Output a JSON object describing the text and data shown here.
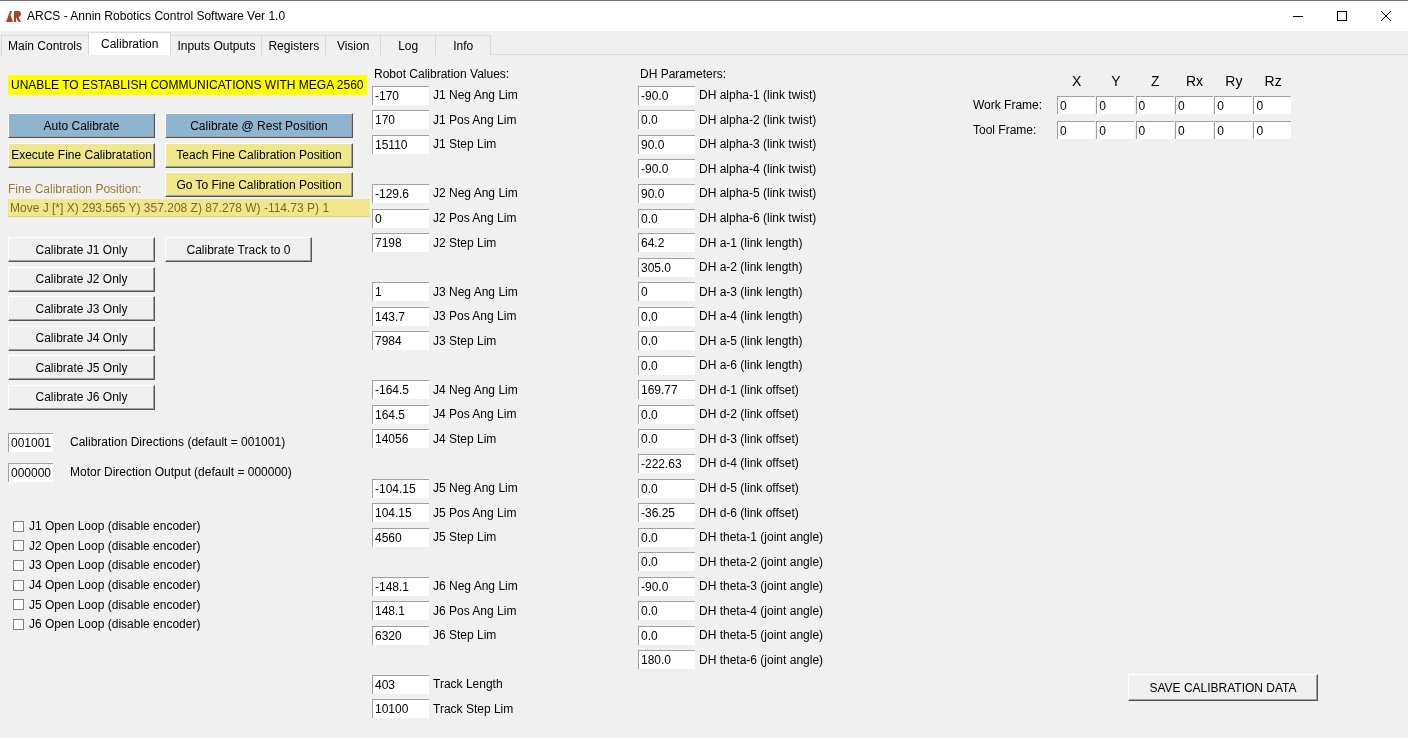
{
  "window": {
    "title": "ARCS - Annin Robotics Control Software Ver 1.0"
  },
  "tabs": [
    {
      "label": "Main Controls",
      "selected": false
    },
    {
      "label": "Calibration",
      "selected": true
    },
    {
      "label": "Inputs Outputs",
      "selected": false
    },
    {
      "label": "Registers",
      "selected": false
    },
    {
      "label": "Vision",
      "selected": false
    },
    {
      "label": "Log",
      "selected": false
    },
    {
      "label": "Info",
      "selected": false
    }
  ],
  "status_message": "UNABLE TO ESTABLISH COMMUNICATIONS WITH MEGA 2560",
  "calibration_buttons": {
    "left": [
      {
        "label": "Auto Calibrate",
        "kind": "auto"
      },
      {
        "label": "Execute Fine Calibratation",
        "kind": "fine"
      }
    ],
    "right": [
      {
        "label": "Calibrate @ Rest Position",
        "kind": "auto"
      },
      {
        "label": "Teach Fine Calibration Position",
        "kind": "fine"
      },
      {
        "label": "Go To Fine Calibration Position",
        "kind": "fine"
      }
    ]
  },
  "fine_calibration_position": {
    "label": "Fine Calibration Position:",
    "value": "Move J [*]  X) 293.565   Y) 357.208   Z) 87.278   W) -114.73   P) 1"
  },
  "joint_buttons": [
    "Calibrate J1 Only",
    "Calibrate J2 Only",
    "Calibrate J3 Only",
    "Calibrate J4 Only",
    "Calibrate J5 Only",
    "Calibrate J6 Only"
  ],
  "track_button": "Calibrate Track to 0",
  "direction_fields": [
    {
      "value": "001001",
      "label": "Calibration Directions (default = 001001)"
    },
    {
      "value": "000000",
      "label": "Motor Direction Output (default = 000000)"
    }
  ],
  "open_loop": [
    {
      "label": "J1 Open Loop (disable encoder)",
      "checked": false
    },
    {
      "label": "J2 Open Loop (disable encoder)",
      "checked": false
    },
    {
      "label": "J3 Open Loop (disable encoder)",
      "checked": false
    },
    {
      "label": "J4 Open Loop (disable encoder)",
      "checked": false
    },
    {
      "label": "J5 Open Loop (disable encoder)",
      "checked": false
    },
    {
      "label": "J6 Open Loop (disable encoder)",
      "checked": false
    }
  ],
  "robot_calibration": {
    "title": "Robot Calibration Values:",
    "groups": [
      [
        {
          "value": "-170",
          "label": "J1 Neg Ang Lim"
        },
        {
          "value": "170",
          "label": "J1 Pos Ang Lim"
        },
        {
          "value": "15110",
          "label": "J1 Step Lim"
        }
      ],
      [
        {
          "value": "-129.6",
          "label": "J2 Neg Ang Lim"
        },
        {
          "value": "0",
          "label": "J2 Pos Ang Lim"
        },
        {
          "value": "7198",
          "label": "J2 Step Lim"
        }
      ],
      [
        {
          "value": "1",
          "label": "J3 Neg Ang Lim"
        },
        {
          "value": "143.7",
          "label": "J3 Pos Ang Lim"
        },
        {
          "value": "7984",
          "label": "J3 Step Lim"
        }
      ],
      [
        {
          "value": "-164.5",
          "label": "J4 Neg Ang Lim"
        },
        {
          "value": "164.5",
          "label": "J4 Pos Ang Lim"
        },
        {
          "value": "14056",
          "label": "J4 Step Lim"
        }
      ],
      [
        {
          "value": "-104.15",
          "label": "J5 Neg Ang Lim"
        },
        {
          "value": "104.15",
          "label": "J5 Pos Ang Lim"
        },
        {
          "value": "4560",
          "label": "J5 Step Lim"
        }
      ],
      [
        {
          "value": "-148.1",
          "label": "J6 Neg Ang Lim"
        },
        {
          "value": "148.1",
          "label": "J6 Pos Ang Lim"
        },
        {
          "value": "6320",
          "label": "J6 Step Lim"
        }
      ],
      [
        {
          "value": "403",
          "label": "Track Length"
        },
        {
          "value": "10100",
          "label": "Track Step Lim"
        }
      ]
    ]
  },
  "dh_parameters": {
    "title": "DH Parameters:",
    "rows": [
      {
        "value": "-90.0",
        "label": "DH alpha-1 (link twist)"
      },
      {
        "value": "0.0",
        "label": "DH alpha-2 (link twist)"
      },
      {
        "value": "90.0",
        "label": "DH alpha-3 (link twist)"
      },
      {
        "value": "-90.0",
        "label": "DH alpha-4 (link twist)"
      },
      {
        "value": "90.0",
        "label": "DH alpha-5 (link twist)"
      },
      {
        "value": "0.0",
        "label": "DH alpha-6 (link twist)"
      },
      {
        "value": "64.2",
        "label": "DH a-1 (link length)"
      },
      {
        "value": "305.0",
        "label": "DH a-2 (link length)"
      },
      {
        "value": "0",
        "label": "DH a-3 (link length)"
      },
      {
        "value": "0.0",
        "label": "DH a-4 (link length)"
      },
      {
        "value": "0.0",
        "label": "DH a-5 (link length)"
      },
      {
        "value": "0.0",
        "label": "DH a-6 (link length)"
      },
      {
        "value": "169.77",
        "label": "DH d-1 (link offset)"
      },
      {
        "value": "0.0",
        "label": "DH d-2 (link offset)"
      },
      {
        "value": "0.0",
        "label": "DH d-3 (link offset)"
      },
      {
        "value": "-222.63",
        "label": "DH d-4 (link offset)"
      },
      {
        "value": "0.0",
        "label": "DH d-5 (link offset)"
      },
      {
        "value": "-36.25",
        "label": "DH d-6 (link offset)"
      },
      {
        "value": "0.0",
        "label": "DH theta-1 (joint angle)"
      },
      {
        "value": "0.0",
        "label": "DH theta-2 (joint angle)"
      },
      {
        "value": "-90.0",
        "label": "DH theta-3 (joint angle)"
      },
      {
        "value": "0.0",
        "label": "DH theta-4 (joint angle)"
      },
      {
        "value": "0.0",
        "label": "DH theta-5 (joint angle)"
      },
      {
        "value": "180.0",
        "label": "DH theta-6 (joint angle)"
      }
    ]
  },
  "frames": {
    "columns": [
      "X",
      "Y",
      "Z",
      "Rx",
      "Ry",
      "Rz"
    ],
    "rows": [
      {
        "label": "Work Frame:",
        "values": [
          "0",
          "0",
          "0",
          "0",
          "0",
          "0"
        ]
      },
      {
        "label": "Tool Frame:",
        "values": [
          "0",
          "0",
          "0",
          "0",
          "0",
          "0"
        ]
      }
    ]
  },
  "save_button": "SAVE CALIBRATION DATA"
}
